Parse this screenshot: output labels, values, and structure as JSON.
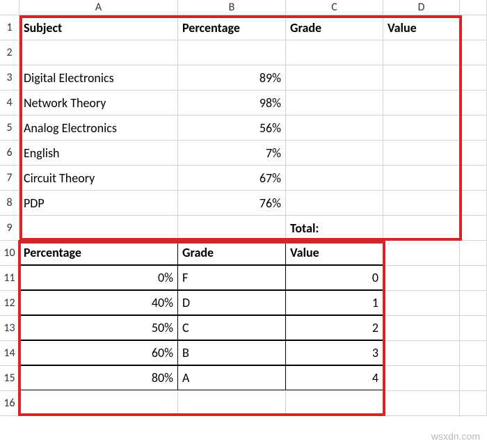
{
  "columns": [
    "A",
    "B",
    "C",
    "D"
  ],
  "rows": [
    "1",
    "2",
    "3",
    "4",
    "5",
    "6",
    "7",
    "8",
    "9",
    "10",
    "11",
    "12",
    "13",
    "14",
    "15",
    "16"
  ],
  "headers1": {
    "subject": "Subject",
    "percentage": "Percentage",
    "grade": "Grade",
    "value": "Value"
  },
  "subjects": [
    {
      "name": "Digital Electronics",
      "pct": "89%"
    },
    {
      "name": "Network Theory",
      "pct": "98%"
    },
    {
      "name": "Analog Electronics",
      "pct": "56%"
    },
    {
      "name": "English",
      "pct": "7%"
    },
    {
      "name": "Circuit Theory",
      "pct": "67%"
    },
    {
      "name": "PDP",
      "pct": "76%"
    }
  ],
  "total_label": "Total:",
  "headers2": {
    "percentage": "Percentage",
    "grade": "Grade",
    "value": "Value"
  },
  "lookup": [
    {
      "pct": "0%",
      "grade": "F",
      "value": "0"
    },
    {
      "pct": "40%",
      "grade": "D",
      "value": "1"
    },
    {
      "pct": "50%",
      "grade": "C",
      "value": "2"
    },
    {
      "pct": "60%",
      "grade": "B",
      "value": "3"
    },
    {
      "pct": "80%",
      "grade": "A",
      "value": "4"
    }
  ],
  "watermark": "wsxdn.com"
}
